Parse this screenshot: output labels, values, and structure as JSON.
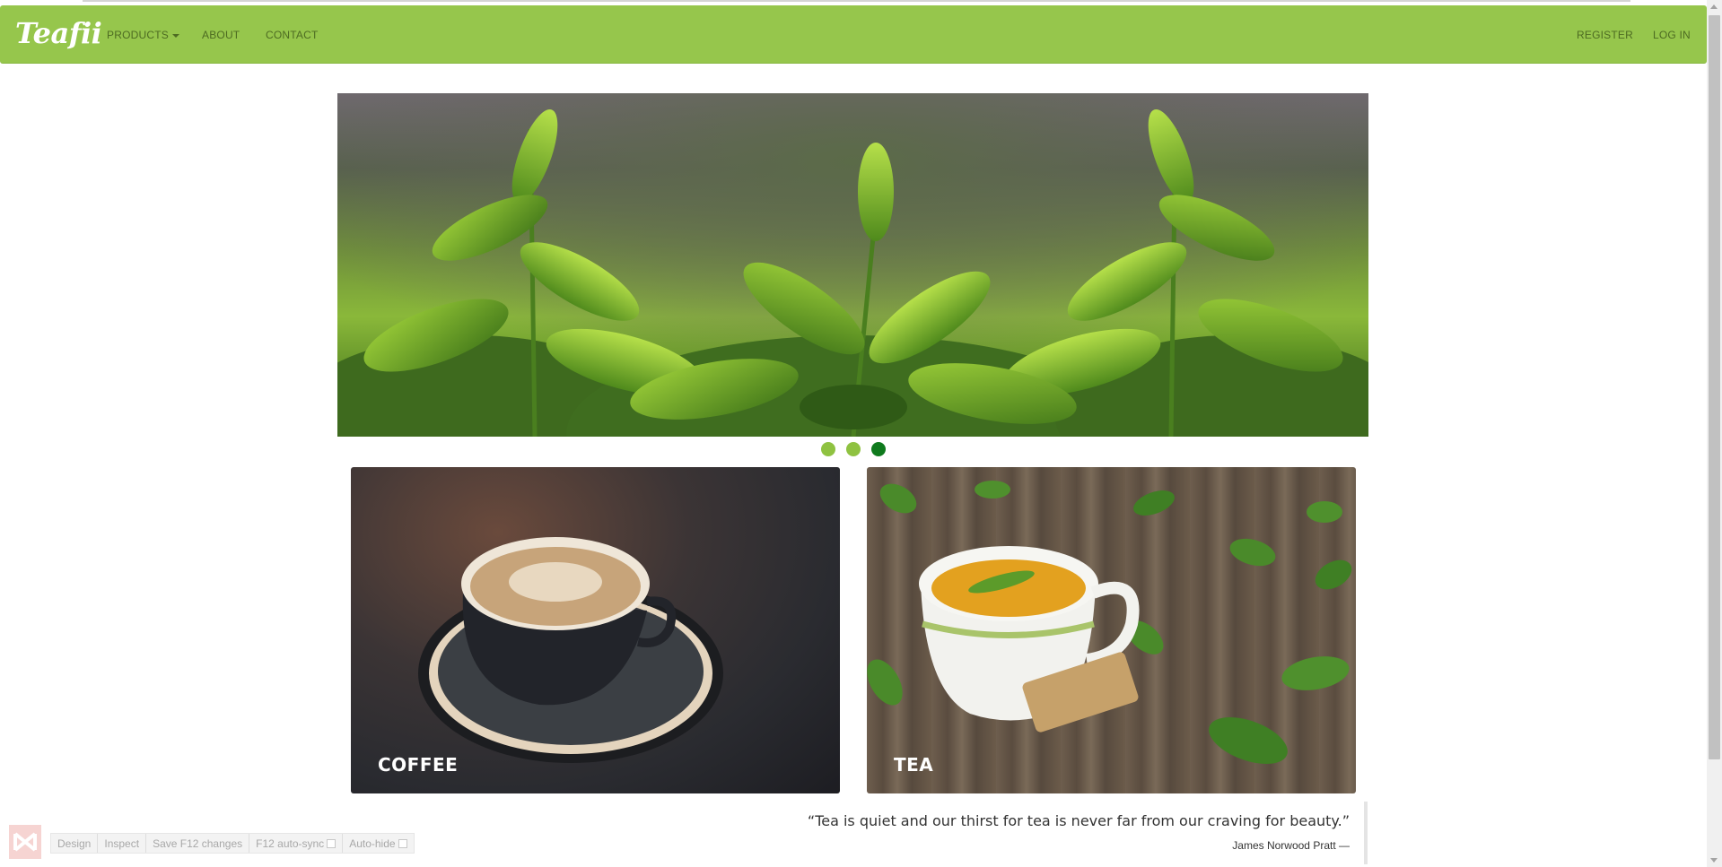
{
  "navbar": {
    "brand": "Teafii",
    "left_items": [
      {
        "label": "PRODUCTS",
        "has_caret": true
      },
      {
        "label": "ABOUT"
      },
      {
        "label": "CONTACT"
      }
    ],
    "right_items": [
      {
        "label": "REGISTER"
      },
      {
        "label": "LOG IN"
      }
    ],
    "color": "#96c64c"
  },
  "carousel": {
    "slide_count": 3,
    "active_index": 2,
    "active_color": "#0f7a1d",
    "inactive_color": "#8fc241"
  },
  "cards": [
    {
      "label": "COFFEE"
    },
    {
      "label": "TEA"
    }
  ],
  "quote": {
    "text": "“Tea is quiet and our thirst for tea is never far from our craving for beauty.”",
    "author": "James Norwood Pratt  —"
  },
  "devtools_bar": {
    "items": [
      {
        "label": "Design"
      },
      {
        "label": "Inspect"
      },
      {
        "label": "Save F12 changes"
      },
      {
        "label": "F12 auto-sync",
        "checked": false
      },
      {
        "label": "Auto-hide",
        "checked": false
      }
    ]
  }
}
